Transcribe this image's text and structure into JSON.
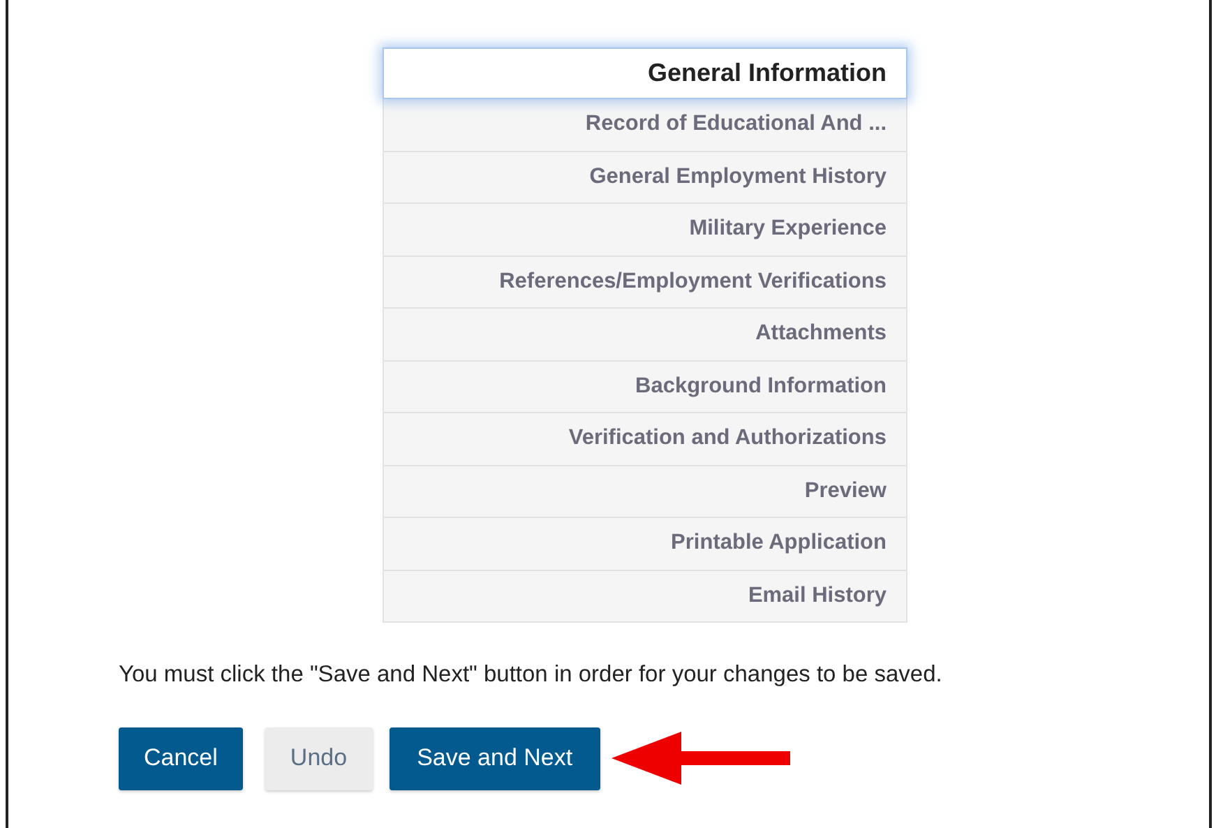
{
  "menu": {
    "items": [
      {
        "label": "General Information",
        "selected": true
      },
      {
        "label": "Record of Educational And ...",
        "selected": false
      },
      {
        "label": "General Employment History",
        "selected": false
      },
      {
        "label": "Military Experience",
        "selected": false
      },
      {
        "label": "References/Employment Verifications",
        "selected": false
      },
      {
        "label": "Attachments",
        "selected": false
      },
      {
        "label": "Background Information",
        "selected": false
      },
      {
        "label": "Verification and Authorizations",
        "selected": false
      },
      {
        "label": "Preview",
        "selected": false
      },
      {
        "label": "Printable Application",
        "selected": false
      },
      {
        "label": "Email History",
        "selected": false
      }
    ]
  },
  "notice": "You must click the \"Save and Next\" button in order for your changes to be saved.",
  "buttons": [
    {
      "label": "Cancel",
      "kind": "primary"
    },
    {
      "label": "Undo",
      "kind": "disabled"
    },
    {
      "label": "Save and Next",
      "kind": "primary"
    }
  ],
  "arrow": {
    "kind": "pointer"
  }
}
